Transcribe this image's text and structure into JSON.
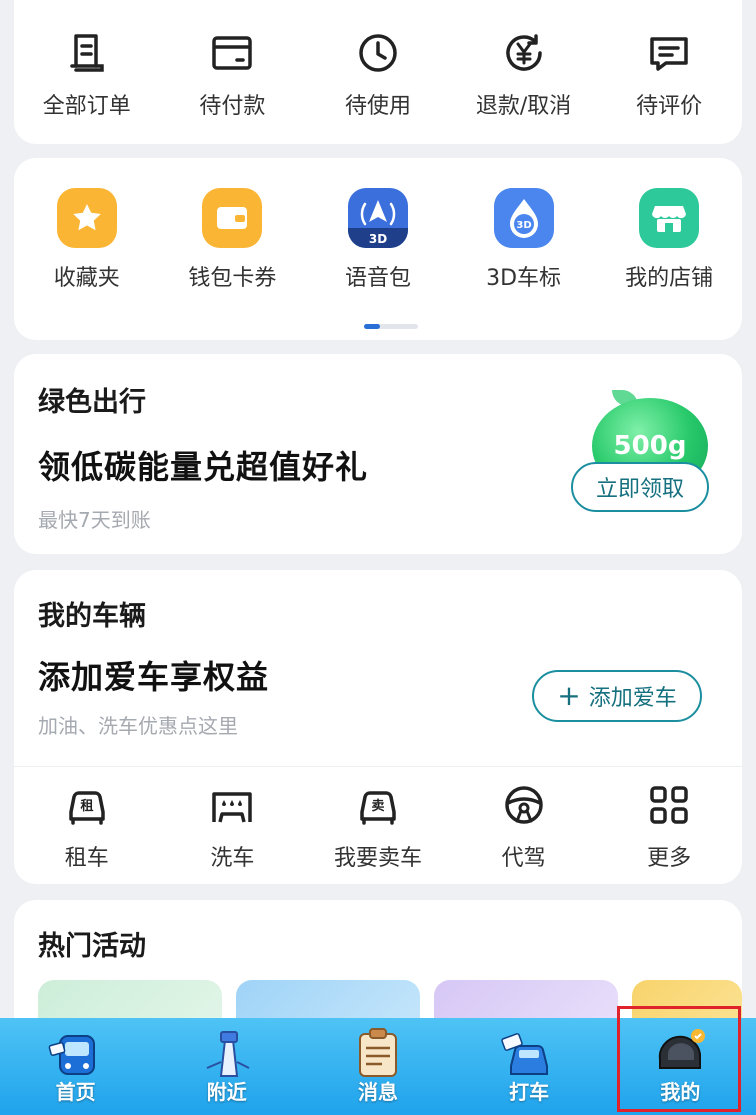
{
  "orders": {
    "items": [
      {
        "label": "全部订单",
        "icon": "order-list-icon"
      },
      {
        "label": "待付款",
        "icon": "wallet-card-icon"
      },
      {
        "label": "待使用",
        "icon": "clock-icon"
      },
      {
        "label": "退款/取消",
        "icon": "refund-yen-icon"
      },
      {
        "label": "待评价",
        "icon": "comment-icon"
      }
    ]
  },
  "tools": {
    "items": [
      {
        "label": "收藏夹",
        "icon": "star-icon",
        "color": "#fbb534"
      },
      {
        "label": "钱包卡券",
        "icon": "wallet-icon",
        "color": "#fbb534"
      },
      {
        "label": "语音包",
        "icon": "voice-pack-icon",
        "color": "#3a6fdc",
        "badge": "3D"
      },
      {
        "label": "3D车标",
        "icon": "3d-car-logo-icon",
        "color": "#4a86ee",
        "badge": "3D"
      },
      {
        "label": "我的店铺",
        "icon": "shop-icon",
        "color": "#2ec99a"
      }
    ]
  },
  "green": {
    "title": "绿色出行",
    "headline": "领低碳能量兑超值好礼",
    "sub": "最快7天到账",
    "energy": "500g",
    "button": "立即领取"
  },
  "vehicle": {
    "title": "我的车辆",
    "headline": "添加爱车享权益",
    "sub": "加油、洗车优惠点这里",
    "button": "添加爱车",
    "services": [
      {
        "label": "租车",
        "icon": "rent-car-icon",
        "badge": "租"
      },
      {
        "label": "洗车",
        "icon": "car-wash-icon"
      },
      {
        "label": "我要卖车",
        "icon": "sell-car-icon",
        "badge": "卖"
      },
      {
        "label": "代驾",
        "icon": "steering-wheel-icon"
      },
      {
        "label": "更多",
        "icon": "grid-more-icon"
      }
    ]
  },
  "hot": {
    "title": "热门活动"
  },
  "tabbar": {
    "items": [
      {
        "label": "首页",
        "icon": "bus-home-icon"
      },
      {
        "label": "附近",
        "icon": "nearby-tower-icon"
      },
      {
        "label": "消息",
        "icon": "message-clipboard-icon"
      },
      {
        "label": "打车",
        "icon": "taxi-icon"
      },
      {
        "label": "我的",
        "icon": "helmet-avatar-icon"
      }
    ]
  },
  "colors": {
    "accent_teal": "#1b8fa0",
    "tabbar": "#1fa3ec",
    "highlight": "#e0222a",
    "energy_green": "#27c96a"
  }
}
